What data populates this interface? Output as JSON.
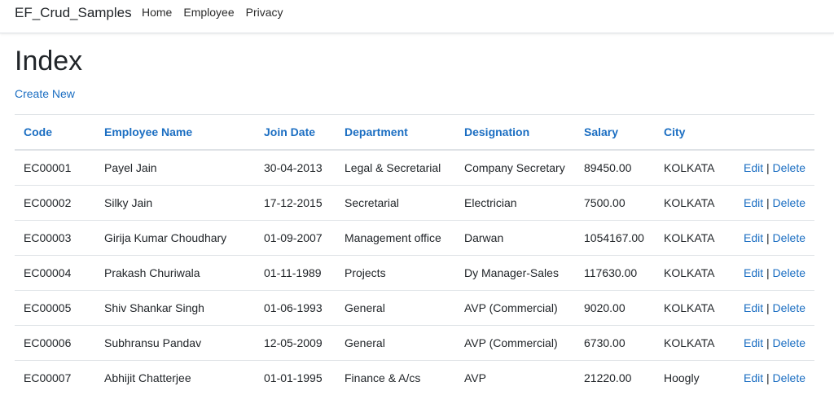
{
  "nav": {
    "brand": "EF_Crud_Samples",
    "links": [
      "Home",
      "Employee",
      "Privacy"
    ]
  },
  "page": {
    "title": "Index",
    "create_link": "Create New"
  },
  "table": {
    "headers": [
      "Code",
      "Employee Name",
      "Join Date",
      "Department",
      "Designation",
      "Salary",
      "City"
    ],
    "edit_label": "Edit",
    "delete_label": "Delete",
    "separator": "|",
    "rows": [
      [
        "EC00001",
        "Payel Jain",
        "30-04-2013",
        "Legal & Secretarial",
        "Company Secretary",
        "89450.00",
        "KOLKATA"
      ],
      [
        "EC00002",
        "Silky Jain",
        "17-12-2015",
        "Secretarial",
        "Electrician",
        "7500.00",
        "KOLKATA"
      ],
      [
        "EC00003",
        "Girija Kumar Choudhary",
        "01-09-2007",
        "Management office",
        "Darwan",
        "1054167.00",
        "KOLKATA"
      ],
      [
        "EC00004",
        "Prakash Churiwala",
        "01-11-1989",
        "Projects",
        "Dy Manager-Sales",
        "117630.00",
        "KOLKATA"
      ],
      [
        "EC00005",
        "Shiv Shankar Singh",
        "01-06-1993",
        "General",
        "AVP (Commercial)",
        "9020.00",
        "KOLKATA"
      ],
      [
        "EC00006",
        "Subhransu Pandav",
        "12-05-2009",
        "General",
        "AVP (Commercial)",
        "6730.00",
        "KOLKATA"
      ],
      [
        "EC00007",
        "Abhijit Chatterjee",
        "01-01-1995",
        "Finance & A/cs",
        "AVP",
        "21220.00",
        "Hoogly"
      ]
    ]
  },
  "colors": {
    "link": "#1b6ec2",
    "text": "#212529",
    "border": "#dee2e6"
  }
}
